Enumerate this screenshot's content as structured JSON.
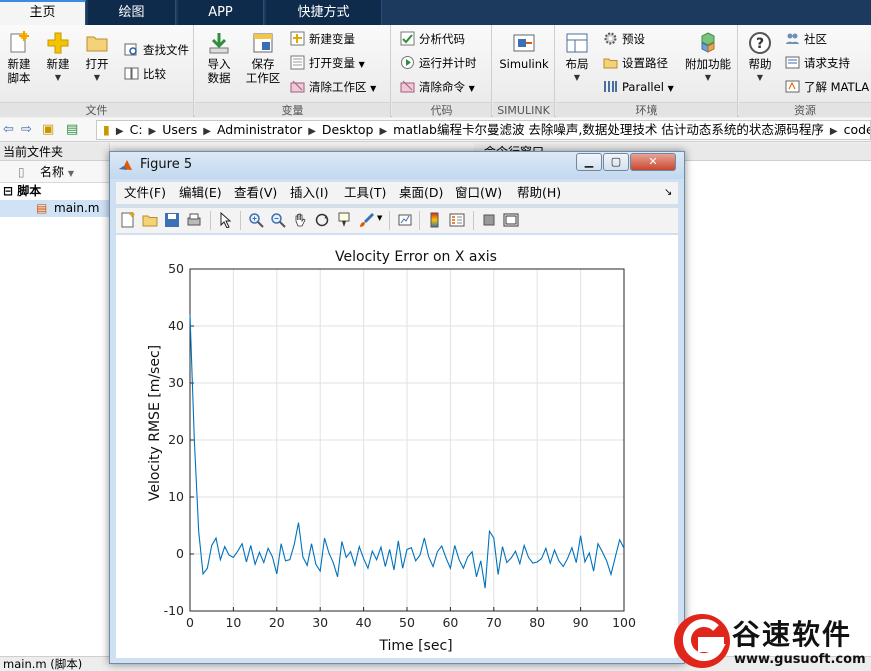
{
  "tabs": [
    {
      "label": "主页",
      "active": true
    },
    {
      "label": "绘图",
      "active": false
    },
    {
      "label": "APP",
      "active": false
    },
    {
      "label": "快捷方式",
      "active": false
    }
  ],
  "ribbon": {
    "file": {
      "group_label": "文件",
      "new_script": "新建\n脚本",
      "new": "新建",
      "open": "打开",
      "find_files": "查找文件",
      "compare": "比较"
    },
    "variable": {
      "group_label": "变量",
      "import_data": "导入\n数据",
      "save_workspace": "保存\n工作区",
      "new_variable": "新建变量",
      "open_variable": "打开变量",
      "clear_workspace": "清除工作区"
    },
    "code": {
      "group_label": "代码",
      "analyze_code": "分析代码",
      "run_and_time": "运行并计时",
      "clear_commands": "清除命令"
    },
    "simulink": {
      "group_label": "SIMULINK",
      "simulink": "Simulink"
    },
    "environment": {
      "group_label": "环境",
      "layout": "布局",
      "preferences": "预设",
      "set_path": "设置路径",
      "parallel": "Parallel",
      "add_ons": "附加功能"
    },
    "resources": {
      "group_label": "资源",
      "help": "帮助",
      "community": "社区",
      "request_support": "请求支持",
      "learn_matlab": "了解 MATLA"
    }
  },
  "address": {
    "crumbs": [
      "C:",
      "Users",
      "Administrator",
      "Desktop",
      "matlab编程卡尔曼滤波 去除噪声,数据处理技术 估计动态系统的状态源码程序",
      "code"
    ]
  },
  "current_folder": {
    "title": "当前文件夹",
    "column_name": "名称",
    "group": "脚本",
    "file": "main.m"
  },
  "command_window": {
    "title": "命令行窗口"
  },
  "status": {
    "text": "main.m  (脚本)"
  },
  "figure": {
    "title": "Figure 5",
    "menu": [
      "文件(F)",
      "编辑(E)",
      "查看(V)",
      "插入(I)",
      "工具(T)",
      "桌面(D)",
      "窗口(W)",
      "帮助(H)"
    ]
  },
  "watermark": {
    "name": "谷速软件",
    "url": "www.gusuoft.com"
  },
  "chart_data": {
    "type": "line",
    "title": "Velocity Error on X axis",
    "xlabel": "Time [sec]",
    "ylabel": "Velocity RMSE [m/sec]",
    "xlim": [
      0,
      100
    ],
    "ylim": [
      -10,
      50
    ],
    "xticks": [
      0,
      10,
      20,
      30,
      40,
      50,
      60,
      70,
      80,
      90,
      100
    ],
    "yticks": [
      -10,
      0,
      10,
      20,
      30,
      40,
      50
    ],
    "grid": true,
    "color": "#0072bd",
    "x": [
      0,
      1,
      2,
      3,
      4,
      5,
      6,
      7,
      8,
      9,
      10,
      11,
      12,
      13,
      14,
      15,
      16,
      17,
      18,
      19,
      20,
      21,
      22,
      23,
      24,
      25,
      26,
      27,
      28,
      29,
      30,
      31,
      32,
      33,
      34,
      35,
      36,
      37,
      38,
      39,
      40,
      41,
      42,
      43,
      44,
      45,
      46,
      47,
      48,
      49,
      50,
      51,
      52,
      53,
      54,
      55,
      56,
      57,
      58,
      59,
      60,
      61,
      62,
      63,
      64,
      65,
      66,
      67,
      68,
      69,
      70,
      71,
      72,
      73,
      74,
      75,
      76,
      77,
      78,
      79,
      80,
      81,
      82,
      83,
      84,
      85,
      86,
      87,
      88,
      89,
      90,
      91,
      92,
      93,
      94,
      95,
      96,
      97,
      98,
      99,
      100
    ],
    "y": [
      42,
      20,
      4,
      -3.5,
      -2.5,
      1.5,
      2.8,
      -1,
      1.3,
      -0.2,
      -0.6,
      0.5,
      1.8,
      -1.4,
      1.5,
      -1.8,
      0.3,
      -1.5,
      1,
      -0.5,
      -3.5,
      1.8,
      -1.2,
      -1,
      1.6,
      5.5,
      -0.5,
      -2,
      1.8,
      -1.8,
      -3,
      2.8,
      0.2,
      -1.5,
      -4,
      2.2,
      -0.6,
      0.4,
      -2,
      1.3,
      -0.8,
      -2.5,
      0.5,
      -1,
      1.2,
      -2.2,
      0.8,
      -2.8,
      2.3,
      -2.5,
      0.8,
      1.1,
      -1.2,
      -0.2,
      2.8,
      -0.5,
      -2.2,
      0.4,
      1.4,
      -0.7,
      -2.5,
      1.5,
      -1,
      -2.5,
      -0.5,
      0.4,
      -4,
      -1.2,
      -6,
      4,
      2.8,
      -3.6,
      1.3,
      -1.5,
      -0.7,
      0.5,
      -1.7,
      1.5,
      -0.6,
      -1.6,
      -1.4,
      -0.8,
      1,
      -1.6,
      0.7,
      -1.2,
      -2.2,
      -0.8,
      1.1,
      -1.5,
      3.2,
      -1.4,
      0.2,
      -3,
      1.8,
      0.4,
      -1.2,
      -3.6,
      -0.5,
      2.5,
      1
    ]
  }
}
